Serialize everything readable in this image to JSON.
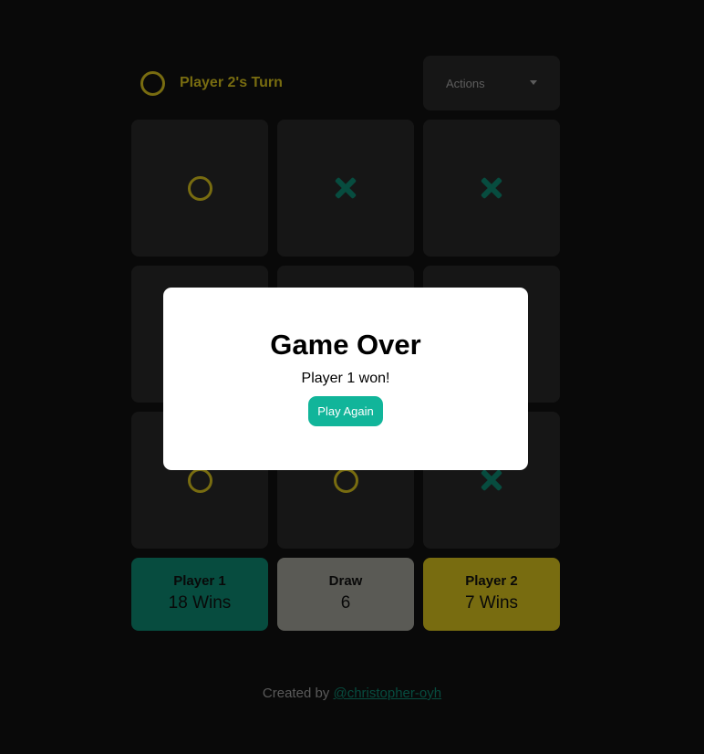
{
  "header": {
    "turn_label": "Player 2's Turn",
    "turn_icon": "o-mark-icon",
    "actions_label": "Actions"
  },
  "board": {
    "cells": [
      "O",
      "X",
      "X",
      "",
      "",
      "",
      "O",
      "O",
      "X"
    ]
  },
  "scores": {
    "player1": {
      "title": "Player 1",
      "value": "18 Wins",
      "color": "#0c7561"
    },
    "draw": {
      "title": "Draw",
      "value": "6",
      "color": "#8b8b83"
    },
    "player2": {
      "title": "Player 2",
      "value": "7 Wins",
      "color": "#b8a619"
    }
  },
  "footer": {
    "prefix": "Created by",
    "link_text": "@christopher-oyh"
  },
  "modal": {
    "title": "Game Over",
    "message": "Player 1 won!",
    "button_label": "Play Again",
    "button_color": "#11b59a"
  },
  "colors": {
    "background": "#0e0e0e",
    "cell": "#232323",
    "o_color": "#b8a619",
    "x_color": "#0c7561"
  }
}
